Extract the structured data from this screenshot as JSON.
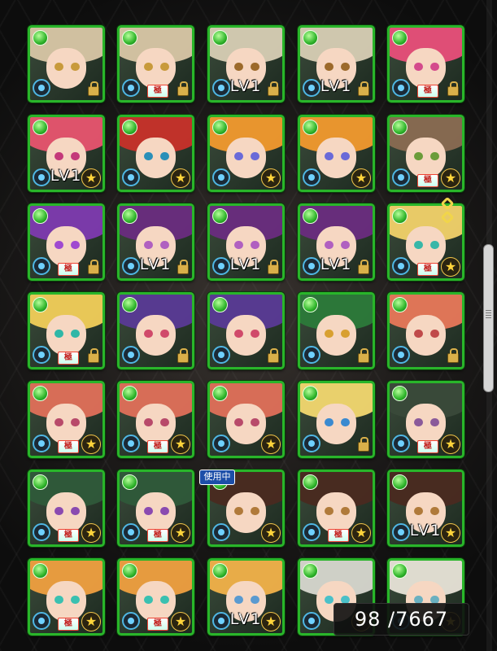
{
  "counter": {
    "text": "98 /7667"
  },
  "in_use_label": "使用中",
  "lv_label": "LV1",
  "goku_label": "極",
  "rows": [
    [
      {
        "hair": "#d9c7a6",
        "eye": "#c89a3b",
        "lv": false,
        "badge": "lock",
        "goku": false
      },
      {
        "hair": "#d9c7a6",
        "eye": "#c89a3b",
        "lv": false,
        "badge": "lock",
        "goku": true
      },
      {
        "hair": "#d8cfb5",
        "eye": "#9c6a2b",
        "lv": true,
        "badge": "lock",
        "goku": false
      },
      {
        "hair": "#d8cfb5",
        "eye": "#9c6a2b",
        "lv": true,
        "badge": "lock",
        "goku": false
      },
      {
        "hair": "#e94f7a",
        "eye": "#d44a8c",
        "lv": false,
        "badge": "lock",
        "goku": true
      }
    ],
    [
      {
        "hair": "#e8546f",
        "eye": "#c4397a",
        "lv": true,
        "badge": "star",
        "goku": false
      },
      {
        "hair": "#c8322a",
        "eye": "#2a8fb8",
        "lv": false,
        "badge": "star",
        "goku": false
      },
      {
        "hair": "#f29a2e",
        "eye": "#6a6ad8",
        "lv": false,
        "badge": "star",
        "goku": false
      },
      {
        "hair": "#f29a2e",
        "eye": "#6a6ad8",
        "lv": false,
        "badge": "star",
        "goku": false
      },
      {
        "hair": "#8a6b52",
        "eye": "#6b9c3a",
        "lv": false,
        "badge": "star",
        "goku": true
      }
    ],
    [
      {
        "hair": "#7e3ab0",
        "eye": "#a04ad0",
        "lv": false,
        "badge": "lock",
        "goku": true
      },
      {
        "hair": "#6a2c80",
        "eye": "#b060c0",
        "lv": true,
        "badge": "lock",
        "goku": false
      },
      {
        "hair": "#6a2c80",
        "eye": "#b060c0",
        "lv": true,
        "badge": "lock",
        "goku": false
      },
      {
        "hair": "#6a2c80",
        "eye": "#b060c0",
        "lv": true,
        "badge": "lock",
        "goku": false
      },
      {
        "hair": "#f2d26a",
        "eye": "#37b7a8",
        "lv": false,
        "badge": "star",
        "goku": true
      }
    ],
    [
      {
        "hair": "#f2cf5a",
        "eye": "#2fb7a7",
        "lv": false,
        "badge": "lock",
        "goku": true
      },
      {
        "hair": "#5a3a96",
        "eye": "#d04a6a",
        "lv": false,
        "badge": "lock",
        "goku": false
      },
      {
        "hair": "#5a3a96",
        "eye": "#d04a6a",
        "lv": false,
        "badge": "lock",
        "goku": false
      },
      {
        "hair": "#2c7a3a",
        "eye": "#d8a030",
        "lv": false,
        "badge": "lock",
        "goku": false
      },
      {
        "hair": "#e8785a",
        "eye": "#c04a4a",
        "lv": false,
        "badge": "lock",
        "goku": false
      }
    ],
    [
      {
        "hair": "#e0705a",
        "eye": "#b84a6a",
        "lv": false,
        "badge": "star",
        "goku": true
      },
      {
        "hair": "#e0705a",
        "eye": "#b84a6a",
        "lv": false,
        "badge": "star",
        "goku": true
      },
      {
        "hair": "#e0705a",
        "eye": "#b84a6a",
        "lv": false,
        "badge": "star",
        "goku": false
      },
      {
        "hair": "#f3d870",
        "eye": "#3a8ad0",
        "lv": false,
        "badge": "lock",
        "goku": false
      },
      {
        "hair": "#3a4a3a",
        "eye": "#8a5a9a",
        "lv": false,
        "badge": "star",
        "goku": true
      }
    ],
    [
      {
        "hair": "#2f5a3a",
        "eye": "#8a4ab0",
        "lv": false,
        "badge": "star",
        "goku": true
      },
      {
        "hair": "#2f5a3a",
        "eye": "#8a4ab0",
        "lv": false,
        "badge": "star",
        "goku": true
      },
      {
        "hair": "#4a2a20",
        "eye": "#b07a3a",
        "lv": false,
        "badge": "star",
        "goku": false
      },
      {
        "hair": "#4a2a20",
        "eye": "#b07a3a",
        "lv": false,
        "badge": "star",
        "goku": true
      },
      {
        "hair": "#4a2a20",
        "eye": "#b07a3a",
        "lv": true,
        "badge": "star",
        "goku": false
      }
    ],
    [
      {
        "hair": "#f0a040",
        "eye": "#3ac0b0",
        "lv": false,
        "badge": "star",
        "goku": true
      },
      {
        "hair": "#f0a040",
        "eye": "#3ac0b0",
        "lv": false,
        "badge": "star",
        "goku": true
      },
      {
        "hair": "#f2b24a",
        "eye": "#5a9ad0",
        "lv": true,
        "badge": "star",
        "goku": false
      },
      {
        "hair": "#d8d8d0",
        "eye": "#4ac0c8",
        "lv": false,
        "badge": "star",
        "goku": false
      },
      {
        "hair": "#e8e4d8",
        "eye": "#6ab0c0",
        "lv": false,
        "badge": "star",
        "goku": false
      }
    ]
  ]
}
